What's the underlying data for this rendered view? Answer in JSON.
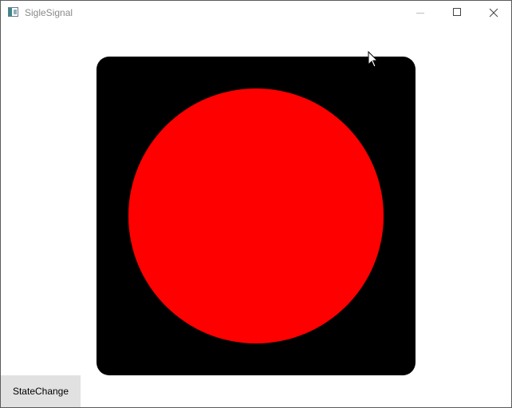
{
  "window": {
    "title": "SigleSignal",
    "icon": "app-window-icon"
  },
  "window_controls": {
    "minimize_icon": "minimize-icon",
    "maximize_icon": "maximize-icon",
    "close_icon": "close-icon"
  },
  "signal": {
    "state_color": "#ff0000",
    "housing_color": "#000000"
  },
  "controls": {
    "state_change_label": "StateChange"
  }
}
